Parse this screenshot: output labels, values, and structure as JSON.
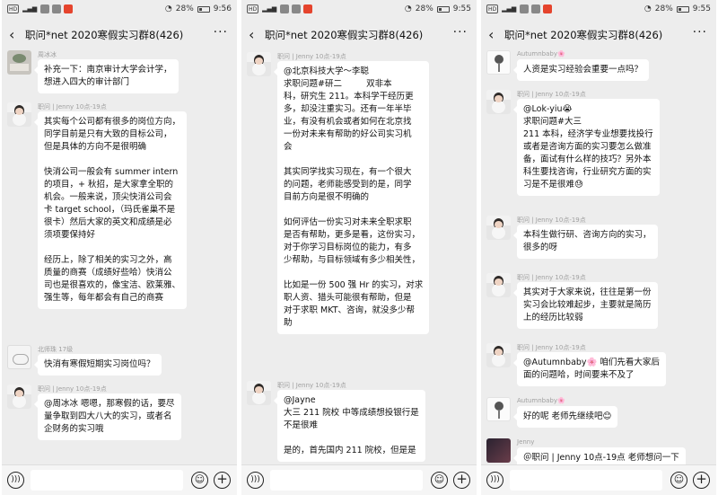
{
  "status_bars": [
    {
      "left_icons": "HD ᵢₗ ᵢₗ",
      "battery": "28%",
      "time": "9:56"
    },
    {
      "left_icons": "HD ᵢₗ ᵢₗ",
      "battery": "28%",
      "time": "9:55"
    },
    {
      "left_icons": "HD ᵢₗ ᵢₗ",
      "battery": "28%",
      "time": "9:55"
    }
  ],
  "chat_title": "职问*net 2020寒假实习群8(426)",
  "icons": {
    "back": "chevron-left-icon",
    "more": "more-dots-icon",
    "voice": "voice-icon",
    "emoji": "emoji-icon",
    "plus": "plus-icon"
  },
  "phones": [
    {
      "messages": [
        {
          "sender": "周冰冰",
          "avatar": "tree",
          "text": "补充一下：南京审计大学会计学，\n想进入四大的审计部门"
        },
        {
          "sender": "职问 | Jenny 10点-19点",
          "avatar": "girl",
          "text": "其实每个公司都有很多的岗位方向，\n同学目前是只有大致的目标公司，\n但是具体的方向不是很明确\n\n快消公司一般会有 summer intern\n的项目，+ 秋招，是大家拿全职的\n机会。一般来说，顶尖快消公司会\n卡 target school，（玛氏雀巢不是\n很卡）然后大家的英文和成绩是必\n须项要保持好\n\n经历上，除了相关的实习之外，高\n质量的商赛（成绩好些哈）快消公\n司也是很喜欢的，像宝洁、欧莱雅、\n强生等，每年都会有自己的商赛"
        },
        {
          "sender": "北师珠 17级",
          "avatar": "cat",
          "text": "快消有寒假短期实习岗位吗？"
        },
        {
          "sender": "职问 | Jenny 10点-19点",
          "avatar": "girl",
          "text": "@周冰冰 嗯嗯，那寒假的话，要尽\n量争取到四大八大的实习，或者名\n企财务的实习哦"
        }
      ]
    },
    {
      "messages": [
        {
          "sender": "职问 | Jenny 10点-19点",
          "avatar": "girl",
          "text": "@北京科技大学～李聪\n求职问题#研二         双非本\n科，研究生 211。本科学干经历更\n多，却没注重实习。还有一年半毕\n业，有没有机会或者如何在北京找\n一份对未来有帮助的好公司实习机\n会\n\n其实同学找实习现在，有一个很大\n的问题，老师能感受到的是，同学\n目前方向是很不明确的\n\n如何评估一份实习对未来全职求职\n是否有帮助，更多是看，这份实习，\n对于你学习目标岗位的能力，有多\n少帮助，与目标领域有多少相关性，\n\n比如是一份 500 强 Hr 的实习，对求\n职人资、猎头可能很有帮助，但是\n对于求职 MKT、咨询，就没多少帮\n助"
        },
        {
          "sender": "职问 | Jenny 10点-19点",
          "avatar": "girl",
          "text": "@Jayne\n大三 211 院校 中等成绩想投银行是\n不是很难\n\n是的，首先国内 211 院校，但是是"
        }
      ]
    },
    {
      "messages": [
        {
          "sender": "Autumnbaby🌸",
          "avatar": "flower",
          "text": "人资是实习经验会重要一点吗？"
        },
        {
          "sender": "职问 | Jenny 10点-19点",
          "avatar": "girl",
          "text": "@Lok-yiu😭\n求职问题#大三\n211 本科，经济学专业想要找投行\n或者是咨询方面的实习要怎么做准\n备，面试有什么样的技巧？另外本\n科生要找咨询，行业研究方面的实\n习是不是很难😓"
        },
        {
          "sender": "职问 | Jenny 10点-19点",
          "avatar": "girl",
          "text": "本科生做行研、咨询方向的实习，\n很多的呀"
        },
        {
          "sender": "职问 | Jenny 10点-19点",
          "avatar": "girl",
          "text": "其实对于大家来说，往往是第一份\n实习会比较难起步，主要就是简历\n上的经历比较弱"
        },
        {
          "sender": "职问 | Jenny 10点-19点",
          "avatar": "girl",
          "text": "@Autumnbaby🌸 咱们先看大家后\n面的问题哈，时间要来不及了"
        },
        {
          "sender": "Autumnbaby🌸",
          "avatar": "flower",
          "text": "好的呢 老师先继续吧😊"
        },
        {
          "sender": "Jenny",
          "avatar": "dark",
          "text": "＠职问 | Jenny 10点-19点 老师想问一下"
        }
      ]
    }
  ]
}
